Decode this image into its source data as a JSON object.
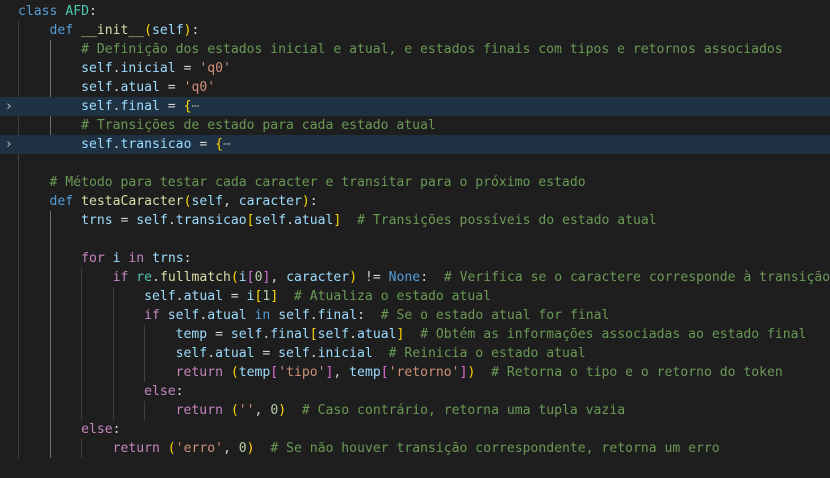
{
  "editor": {
    "language": "python",
    "theme": "dark",
    "colors": {
      "background": "#1e1e1e",
      "folded_line_highlight": "#1f3244",
      "keyword": "#569cd6",
      "control_keyword": "#c586c0",
      "function": "#dcdcaa",
      "class_name": "#4ec9b0",
      "variable": "#9cdcfe",
      "string": "#ce9178",
      "number": "#b5cea8",
      "comment": "#6a9955",
      "bracket_level_1": "#ffd700",
      "bracket_level_2": "#da70d6",
      "bracket_level_3": "#179fff"
    },
    "fold_icon": "chevron-right-icon",
    "lines": [
      {
        "indent": 0,
        "folded": false,
        "tokens": [
          {
            "t": "class",
            "c": "kw"
          },
          {
            "t": " "
          },
          {
            "t": "AFD",
            "c": "cls"
          },
          {
            "t": ":",
            "c": "pun"
          }
        ]
      },
      {
        "indent": 1,
        "folded": false,
        "tokens": [
          {
            "t": "def",
            "c": "kw"
          },
          {
            "t": " "
          },
          {
            "t": "__init__",
            "c": "fn"
          },
          {
            "t": "(",
            "c": "br1"
          },
          {
            "t": "self",
            "c": "prm"
          },
          {
            "t": ")",
            "c": "br1"
          },
          {
            "t": ":",
            "c": "pun"
          }
        ]
      },
      {
        "indent": 2,
        "folded": false,
        "tokens": [
          {
            "t": "# Definição dos estados inicial e atual, e estados finais com tipos e retornos associados",
            "c": "cmt"
          }
        ]
      },
      {
        "indent": 2,
        "folded": false,
        "tokens": [
          {
            "t": "self",
            "c": "var"
          },
          {
            "t": ".",
            "c": "pun"
          },
          {
            "t": "inicial",
            "c": "var"
          },
          {
            "t": " = ",
            "c": "op"
          },
          {
            "t": "'q0'",
            "c": "str"
          }
        ]
      },
      {
        "indent": 2,
        "folded": false,
        "tokens": [
          {
            "t": "self",
            "c": "var"
          },
          {
            "t": ".",
            "c": "pun"
          },
          {
            "t": "atual",
            "c": "var"
          },
          {
            "t": " = ",
            "c": "op"
          },
          {
            "t": "'q0'",
            "c": "str"
          }
        ]
      },
      {
        "indent": 2,
        "folded": true,
        "tokens": [
          {
            "t": "self",
            "c": "var"
          },
          {
            "t": ".",
            "c": "pun"
          },
          {
            "t": "final",
            "c": "var"
          },
          {
            "t": " = ",
            "c": "op"
          },
          {
            "t": "{",
            "c": "br1"
          },
          {
            "t": "⋯",
            "c": "fold-ellipsis"
          }
        ]
      },
      {
        "indent": 2,
        "folded": false,
        "tokens": [
          {
            "t": "# Transições de estado para cada estado atual",
            "c": "cmt"
          }
        ]
      },
      {
        "indent": 2,
        "folded": true,
        "tokens": [
          {
            "t": "self",
            "c": "var"
          },
          {
            "t": ".",
            "c": "pun"
          },
          {
            "t": "transicao",
            "c": "var"
          },
          {
            "t": " = ",
            "c": "op"
          },
          {
            "t": "{",
            "c": "br1"
          },
          {
            "t": "⋯",
            "c": "fold-ellipsis"
          }
        ]
      },
      {
        "indent": 0,
        "folded": false,
        "tokens": []
      },
      {
        "indent": 1,
        "folded": false,
        "tokens": [
          {
            "t": "# Método para testar cada caracter e transitar para o próximo estado",
            "c": "cmt"
          }
        ]
      },
      {
        "indent": 1,
        "folded": false,
        "tokens": [
          {
            "t": "def",
            "c": "kw"
          },
          {
            "t": " "
          },
          {
            "t": "testaCaracter",
            "c": "fn"
          },
          {
            "t": "(",
            "c": "br1"
          },
          {
            "t": "self",
            "c": "prm"
          },
          {
            "t": ", ",
            "c": "pun"
          },
          {
            "t": "caracter",
            "c": "prm"
          },
          {
            "t": ")",
            "c": "br1"
          },
          {
            "t": ":",
            "c": "pun"
          }
        ]
      },
      {
        "indent": 2,
        "folded": false,
        "tokens": [
          {
            "t": "trns",
            "c": "var"
          },
          {
            "t": " = ",
            "c": "op"
          },
          {
            "t": "self",
            "c": "var"
          },
          {
            "t": ".",
            "c": "pun"
          },
          {
            "t": "transicao",
            "c": "var"
          },
          {
            "t": "[",
            "c": "br1"
          },
          {
            "t": "self",
            "c": "var"
          },
          {
            "t": ".",
            "c": "pun"
          },
          {
            "t": "atual",
            "c": "var"
          },
          {
            "t": "]",
            "c": "br1"
          },
          {
            "t": "  "
          },
          {
            "t": "# Transições possíveis do estado atual",
            "c": "cmt"
          }
        ]
      },
      {
        "indent": 0,
        "folded": false,
        "tokens": []
      },
      {
        "indent": 2,
        "folded": false,
        "tokens": [
          {
            "t": "for",
            "c": "ctl"
          },
          {
            "t": " "
          },
          {
            "t": "i",
            "c": "var"
          },
          {
            "t": " "
          },
          {
            "t": "in",
            "c": "ctl"
          },
          {
            "t": " "
          },
          {
            "t": "trns",
            "c": "var"
          },
          {
            "t": ":",
            "c": "pun"
          }
        ]
      },
      {
        "indent": 3,
        "folded": false,
        "tokens": [
          {
            "t": "if",
            "c": "ctl"
          },
          {
            "t": " "
          },
          {
            "t": "re",
            "c": "cls"
          },
          {
            "t": ".",
            "c": "pun"
          },
          {
            "t": "fullmatch",
            "c": "fn"
          },
          {
            "t": "(",
            "c": "br1"
          },
          {
            "t": "i",
            "c": "var"
          },
          {
            "t": "[",
            "c": "br2"
          },
          {
            "t": "0",
            "c": "num"
          },
          {
            "t": "]",
            "c": "br2"
          },
          {
            "t": ", ",
            "c": "pun"
          },
          {
            "t": "caracter",
            "c": "var"
          },
          {
            "t": ")",
            "c": "br1"
          },
          {
            "t": " != ",
            "c": "op"
          },
          {
            "t": "None",
            "c": "kw"
          },
          {
            "t": ":",
            "c": "pun"
          },
          {
            "t": "  "
          },
          {
            "t": "# Verifica se o caractere corresponde à transição",
            "c": "cmt"
          }
        ]
      },
      {
        "indent": 4,
        "folded": false,
        "tokens": [
          {
            "t": "self",
            "c": "var"
          },
          {
            "t": ".",
            "c": "pun"
          },
          {
            "t": "atual",
            "c": "var"
          },
          {
            "t": " = ",
            "c": "op"
          },
          {
            "t": "i",
            "c": "var"
          },
          {
            "t": "[",
            "c": "br1"
          },
          {
            "t": "1",
            "c": "num"
          },
          {
            "t": "]",
            "c": "br1"
          },
          {
            "t": "  "
          },
          {
            "t": "# Atualiza o estado atual",
            "c": "cmt"
          }
        ]
      },
      {
        "indent": 4,
        "folded": false,
        "tokens": [
          {
            "t": "if",
            "c": "ctl"
          },
          {
            "t": " "
          },
          {
            "t": "self",
            "c": "var"
          },
          {
            "t": ".",
            "c": "pun"
          },
          {
            "t": "atual",
            "c": "var"
          },
          {
            "t": " "
          },
          {
            "t": "in",
            "c": "kw"
          },
          {
            "t": " "
          },
          {
            "t": "self",
            "c": "var"
          },
          {
            "t": ".",
            "c": "pun"
          },
          {
            "t": "final",
            "c": "var"
          },
          {
            "t": ":",
            "c": "pun"
          },
          {
            "t": "  "
          },
          {
            "t": "# Se o estado atual for final",
            "c": "cmt"
          }
        ]
      },
      {
        "indent": 5,
        "folded": false,
        "tokens": [
          {
            "t": "temp",
            "c": "var"
          },
          {
            "t": " = ",
            "c": "op"
          },
          {
            "t": "self",
            "c": "var"
          },
          {
            "t": ".",
            "c": "pun"
          },
          {
            "t": "final",
            "c": "var"
          },
          {
            "t": "[",
            "c": "br1"
          },
          {
            "t": "self",
            "c": "var"
          },
          {
            "t": ".",
            "c": "pun"
          },
          {
            "t": "atual",
            "c": "var"
          },
          {
            "t": "]",
            "c": "br1"
          },
          {
            "t": "  "
          },
          {
            "t": "# Obtém as informações associadas ao estado final",
            "c": "cmt"
          }
        ]
      },
      {
        "indent": 5,
        "folded": false,
        "tokens": [
          {
            "t": "self",
            "c": "var"
          },
          {
            "t": ".",
            "c": "pun"
          },
          {
            "t": "atual",
            "c": "var"
          },
          {
            "t": " = ",
            "c": "op"
          },
          {
            "t": "self",
            "c": "var"
          },
          {
            "t": ".",
            "c": "pun"
          },
          {
            "t": "inicial",
            "c": "var"
          },
          {
            "t": "  "
          },
          {
            "t": "# Reinicia o estado atual",
            "c": "cmt"
          }
        ]
      },
      {
        "indent": 5,
        "folded": false,
        "tokens": [
          {
            "t": "return",
            "c": "ctl"
          },
          {
            "t": " "
          },
          {
            "t": "(",
            "c": "br1"
          },
          {
            "t": "temp",
            "c": "var"
          },
          {
            "t": "[",
            "c": "br2"
          },
          {
            "t": "'tipo'",
            "c": "str"
          },
          {
            "t": "]",
            "c": "br2"
          },
          {
            "t": ", ",
            "c": "pun"
          },
          {
            "t": "temp",
            "c": "var"
          },
          {
            "t": "[",
            "c": "br2"
          },
          {
            "t": "'retorno'",
            "c": "str"
          },
          {
            "t": "]",
            "c": "br2"
          },
          {
            "t": ")",
            "c": "br1"
          },
          {
            "t": "  "
          },
          {
            "t": "# Retorna o tipo e o retorno do token",
            "c": "cmt"
          }
        ]
      },
      {
        "indent": 4,
        "folded": false,
        "tokens": [
          {
            "t": "else",
            "c": "ctl"
          },
          {
            "t": ":",
            "c": "pun"
          }
        ]
      },
      {
        "indent": 5,
        "folded": false,
        "tokens": [
          {
            "t": "return",
            "c": "ctl"
          },
          {
            "t": " "
          },
          {
            "t": "(",
            "c": "br1"
          },
          {
            "t": "''",
            "c": "str"
          },
          {
            "t": ", ",
            "c": "pun"
          },
          {
            "t": "0",
            "c": "num"
          },
          {
            "t": ")",
            "c": "br1"
          },
          {
            "t": "  "
          },
          {
            "t": "# Caso contrário, retorna uma tupla vazia",
            "c": "cmt"
          }
        ]
      },
      {
        "indent": 2,
        "folded": false,
        "tokens": [
          {
            "t": "else",
            "c": "ctl"
          },
          {
            "t": ":",
            "c": "pun"
          }
        ]
      },
      {
        "indent": 3,
        "folded": false,
        "tokens": [
          {
            "t": "return",
            "c": "ctl"
          },
          {
            "t": " "
          },
          {
            "t": "(",
            "c": "br1"
          },
          {
            "t": "'erro'",
            "c": "str"
          },
          {
            "t": ", ",
            "c": "pun"
          },
          {
            "t": "0",
            "c": "num"
          },
          {
            "t": ")",
            "c": "br1"
          },
          {
            "t": "  "
          },
          {
            "t": "# Se não houver transição correspondente, retorna um erro",
            "c": "cmt"
          }
        ]
      }
    ]
  }
}
